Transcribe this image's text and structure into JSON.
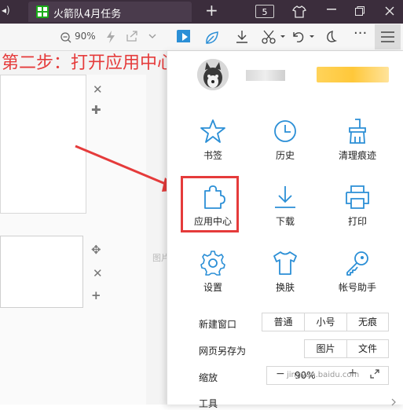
{
  "window": {
    "tab_title": "火箭队4月任务",
    "tab_count": "5"
  },
  "toolbar": {
    "zoom": "90%"
  },
  "annotation": {
    "step_note": "第二步：打开应用中心"
  },
  "background": {
    "partial_text": "图片"
  },
  "menu": {
    "grid": [
      {
        "label": "书签",
        "icon": "star-icon"
      },
      {
        "label": "历史",
        "icon": "clock-icon"
      },
      {
        "label": "清理痕迹",
        "icon": "broom-icon"
      },
      {
        "label": "应用中心",
        "icon": "puzzle-icon"
      },
      {
        "label": "下载",
        "icon": "download-icon"
      },
      {
        "label": "打印",
        "icon": "printer-icon"
      },
      {
        "label": "设置",
        "icon": "gear-icon"
      },
      {
        "label": "换肤",
        "icon": "shirt-icon"
      },
      {
        "label": "帐号助手",
        "icon": "key-icon"
      }
    ],
    "new_window": {
      "label": "新建窗口",
      "options": [
        "普通",
        "小号",
        "无痕"
      ]
    },
    "save_as": {
      "label": "网页另存为",
      "options": [
        "图片",
        "文件"
      ]
    },
    "zoom": {
      "label": "缩放",
      "minus": "−",
      "value": "90%",
      "plus": "+"
    },
    "tools_label": "工具"
  },
  "watermark": "jingyan.baidu.com",
  "colors": {
    "accent": "#2b8fd6",
    "highlight": "#e53b3b",
    "titlebar": "#3b2d3c"
  }
}
